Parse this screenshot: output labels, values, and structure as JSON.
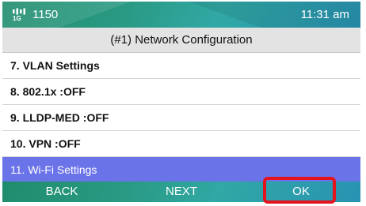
{
  "status_bar": {
    "network_icon": "wired-network-icon",
    "extension": "1150",
    "time": "11:31 am"
  },
  "title": "(#1) Network Configuration",
  "menu": {
    "items": [
      {
        "label": "7. VLAN Settings",
        "selected": false
      },
      {
        "label": "8. 802.1x :OFF",
        "selected": false
      },
      {
        "label": "9. LLDP-MED :OFF",
        "selected": false
      },
      {
        "label": "10. VPN :OFF",
        "selected": false
      },
      {
        "label": "11. Wi-Fi Settings",
        "selected": true
      }
    ]
  },
  "softkeys": {
    "back": "BACK",
    "next": "NEXT",
    "ok": "OK"
  },
  "colors": {
    "accent_selected": "#6b73e8",
    "status_bar": "#2a9a84",
    "highlight_box": "#e3141e"
  }
}
